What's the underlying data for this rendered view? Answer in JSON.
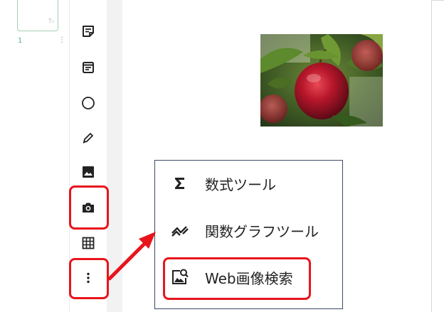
{
  "slide_panel": {
    "page_number": "1",
    "thumbnail_icon": "text-frame-icon",
    "menu_icon": "more-vertical-icon"
  },
  "toolbar": {
    "tools": [
      {
        "name": "sticky-note-icon"
      },
      {
        "name": "text-box-icon"
      },
      {
        "name": "shape-circle-icon"
      },
      {
        "name": "pen-icon"
      },
      {
        "name": "image-icon"
      },
      {
        "name": "camera-icon"
      },
      {
        "name": "table-icon"
      },
      {
        "name": "more-vertical-icon"
      }
    ]
  },
  "canvas": {
    "image": "apple-photo"
  },
  "more_menu": {
    "items": [
      {
        "label": "数式ツール",
        "icon": "sigma-icon"
      },
      {
        "label": "関数グラフツール",
        "icon": "function-graph-icon"
      },
      {
        "label": "Web画像検索",
        "icon": "image-search-icon"
      }
    ]
  },
  "annotations": {
    "highlight_color": "#e8141c"
  }
}
